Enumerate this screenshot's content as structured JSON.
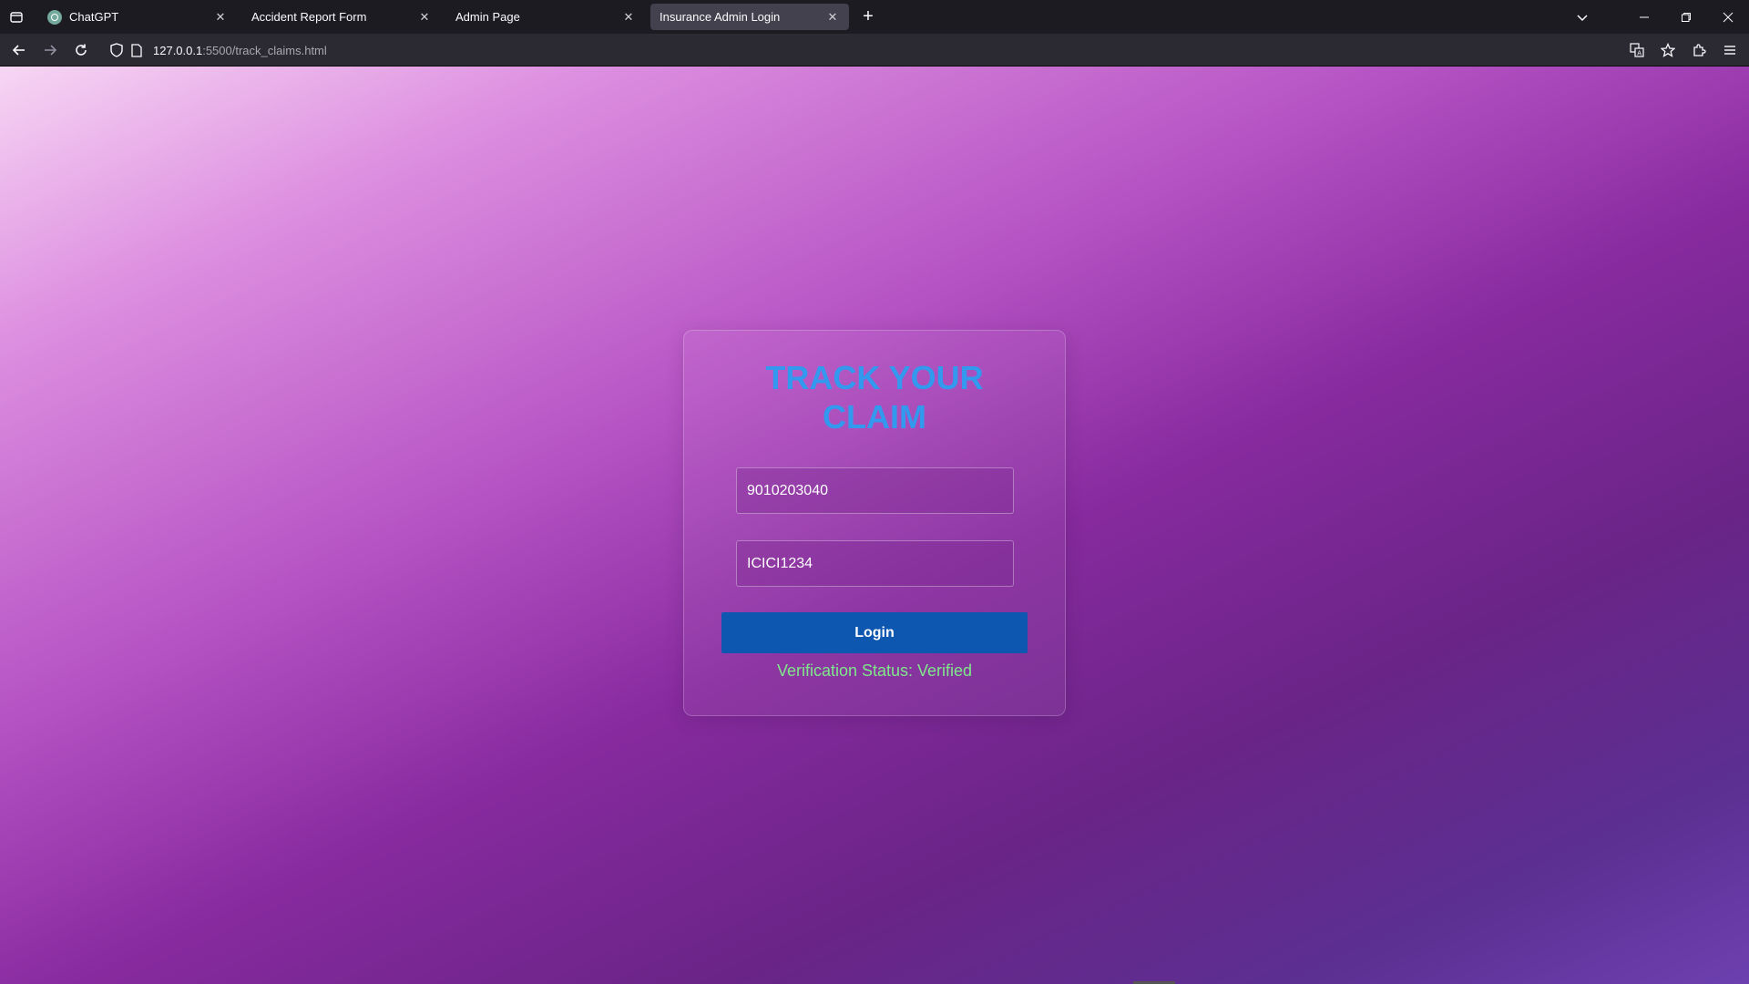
{
  "browser": {
    "tabs": [
      {
        "title": "ChatGPT",
        "active": false
      },
      {
        "title": "Accident Report Form",
        "active": false
      },
      {
        "title": "Admin Page",
        "active": false
      },
      {
        "title": "Insurance Admin Login",
        "active": true
      }
    ],
    "url_host": "127.0.0.1",
    "url_path": ":5500/track_claims.html",
    "icons": {
      "tab_overview": "tab-overview-icon",
      "new_tab": "plus-icon",
      "list_all_tabs": "chevron-down-icon",
      "minimize": "minimize-icon",
      "restore": "restore-icon",
      "close_window": "close-icon",
      "back": "back-arrow-icon",
      "forward": "forward-arrow-icon",
      "reload": "reload-icon",
      "tracking_protection": "shield-icon",
      "page_info": "page-icon",
      "translate": "translate-icon",
      "bookmark": "star-icon",
      "extensions": "puzzle-icon",
      "menu": "hamburger-menu-icon"
    }
  },
  "page": {
    "title_line1": "TRACK YOUR",
    "title_line2": "CLAIM",
    "phone_value": "9010203040",
    "policy_value": "ICICI1234",
    "login_label": "Login",
    "status_text": "Verification Status: Verified",
    "colors": {
      "title": "#3399ee",
      "button": "#0d57b0",
      "status": "#7fe88a"
    }
  }
}
